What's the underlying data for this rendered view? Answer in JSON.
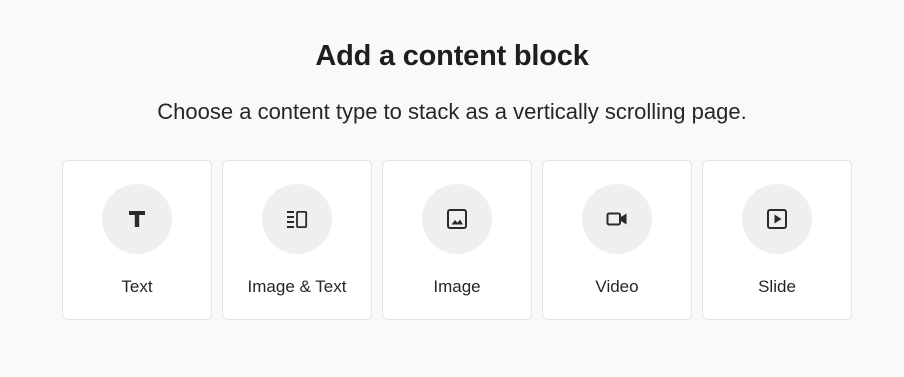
{
  "heading": "Add a content block",
  "subheading": "Choose a content type to stack as a vertically scrolling page.",
  "blocks": [
    {
      "label": "Text",
      "icon": "text-icon"
    },
    {
      "label": "Image & Text",
      "icon": "image-text-icon"
    },
    {
      "label": "Image",
      "icon": "image-icon"
    },
    {
      "label": "Video",
      "icon": "video-icon"
    },
    {
      "label": "Slide",
      "icon": "slide-icon"
    }
  ],
  "colors": {
    "background": "#f9f9f9",
    "card": "#ffffff",
    "icon_circle": "#efeff0",
    "icon": "#2b2b2b"
  }
}
